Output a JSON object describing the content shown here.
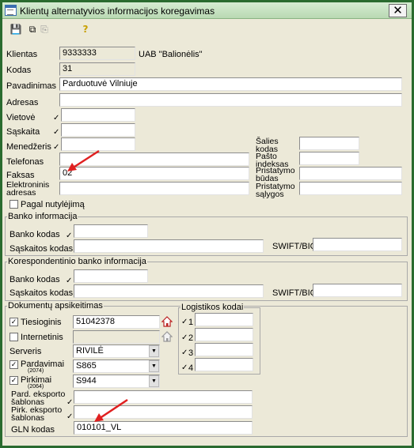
{
  "window": {
    "title": "Klientų alternatyvios informacijos koregavimas",
    "close": "✕"
  },
  "toolbar": {
    "save": "💾",
    "links": "⧉",
    "copy": "⎘",
    "help": "?"
  },
  "checkmark": "✓",
  "checkbox_checked": "✓",
  "colors": {
    "window_bg": "#ece9d8",
    "title_bg": "#c4e2bf",
    "arrow": "#e02020"
  },
  "fields": {
    "klientas": {
      "label": "Klientas",
      "value": "9333333",
      "name": "UAB \"Balionėlis\""
    },
    "kodas": {
      "label": "Kodas",
      "value": "31"
    },
    "pavadinimas": {
      "label": "Pavadinimas",
      "value": "Parduotuvė Vilniuje"
    },
    "adresas": {
      "label": "Adresas",
      "value": ""
    },
    "vietove": {
      "label": "Vietovė",
      "value": ""
    },
    "saskaita": {
      "label": "Sąskaita",
      "value": ""
    },
    "menedzeris": {
      "label": "Menedžeris",
      "value": ""
    },
    "telefonas": {
      "label": "Telefonas",
      "value": ""
    },
    "faksas": {
      "label": "Faksas",
      "value": "02"
    },
    "el_adresas": {
      "label_1": "Elektroninis",
      "label_2": "adresas",
      "value": ""
    },
    "salies_kodas": {
      "label_1": "Šalies",
      "label_2": "kodas",
      "value": ""
    },
    "pasto_indeksas": {
      "label_1": "Pašto",
      "label_2": "indeksas",
      "value": ""
    },
    "pristatymo_budas": {
      "label_1": "Pristatymo",
      "label_2": "būdas",
      "value": ""
    },
    "pristatymo_salygos": {
      "label_1": "Pristatymo",
      "label_2": "sąlygos",
      "value": ""
    },
    "pagal_nutylejima": {
      "label": "Pagal nutylėjimą",
      "checked": false
    }
  },
  "banko": {
    "title": "Banko informacija",
    "banko_kodas": "Banko kodas",
    "saskaitos_kodas": "Sąskaitos kodas",
    "swift": "SWIFT/BIC"
  },
  "koresp": {
    "title": "Korespondentinio banko informacija",
    "banko_kodas": "Banko kodas",
    "saskaitos_kodas": "Sąskaitos kodas",
    "swift": "SWIFT/BIC"
  },
  "dokumentu": {
    "title": "Dokumentų apsikeitimas",
    "tiesioginis": {
      "label": "Tiesioginis",
      "checked": true,
      "value": "51042378"
    },
    "internetinis": {
      "label": "Internetinis",
      "checked": false,
      "value": ""
    },
    "serveris": {
      "label": "Serveris",
      "value": "RIVILĖ"
    },
    "pardavimai": {
      "label": "Pardavimai",
      "sub": "(2074)",
      "checked": true,
      "value": "S865"
    },
    "pirkimai": {
      "label": "Pirkimai",
      "sub": "(2064)",
      "checked": true,
      "value": "S944"
    },
    "pard_eksporto": {
      "label_1": "Pard. eksporto",
      "label_2": "šablonas",
      "value": ""
    },
    "pirk_eksporto": {
      "label_1": "Pirk. eksporto",
      "label_2": "šablonas",
      "value": ""
    },
    "gln": {
      "label": "GLN kodas",
      "value": "010101_VL"
    }
  },
  "logistikos": {
    "title": "Logistikos kodai",
    "items": [
      {
        "num": "1",
        "value": ""
      },
      {
        "num": "2",
        "value": ""
      },
      {
        "num": "3",
        "value": ""
      },
      {
        "num": "4",
        "value": ""
      }
    ]
  }
}
